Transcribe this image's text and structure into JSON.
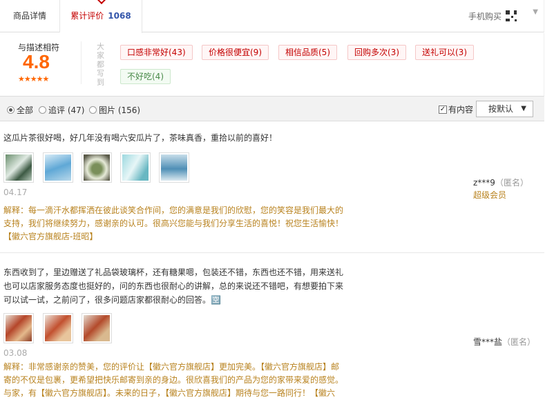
{
  "tabs": {
    "detail_label": "商品详情",
    "reviews_label": "累计评价",
    "reviews_count": "1068",
    "mobile_buy": "手机购买"
  },
  "summary": {
    "score_label": "与描述相符",
    "score": "4.8",
    "stars": "★★★★★",
    "side_label": "大家都写到",
    "tags": [
      {
        "label": "口感非常好(43)",
        "sentiment": "positive"
      },
      {
        "label": "价格很便宜(9)",
        "sentiment": "positive"
      },
      {
        "label": "相信品质(5)",
        "sentiment": "positive"
      },
      {
        "label": "回购多次(3)",
        "sentiment": "positive"
      },
      {
        "label": "送礼可以(3)",
        "sentiment": "positive"
      },
      {
        "label": "不好吃(4)",
        "sentiment": "negative"
      }
    ]
  },
  "filters": {
    "all": "全部",
    "followup": "追评 (47)",
    "pictures": "图片 (156)",
    "selected": "全部",
    "has_content": "有内容",
    "has_content_checked": true,
    "sort_label": "按默认"
  },
  "reviews": [
    {
      "text": "这瓜片茶很好喝，好几年没有喝六安瓜片了，茶味真香，重拾以前的喜好！",
      "date": "04.17",
      "user": "z***9",
      "anon": "（匿名）",
      "level": "超级会员",
      "reply": "解释：每一滴汗水都挥洒在彼此谈笑合作间，您的满意是我们的欣慰，您的笑容是我们最大的支持，我们将继续努力，感谢亲的认可。很高兴您能与我们分享生活的喜悦！祝您生活愉快！【徽六官方旗舰店-班昭】"
    },
    {
      "text": "东西收到了，里边赠送了礼品袋玻璃杯，还有糖果嗯，包装还不错，东西也还不错，用来送礼也可以店家服务态度也挺好的，问的东西也很耐心的讲解，总的来说还不错吧，有想要拍下来可以试一试，之前问了，很多问题店家都很耐心的回答。🈳",
      "date": "03.08",
      "user": "雪***盐",
      "anon": "（匿名）",
      "reply": "解释：非常感谢亲的赞美，您的评价让【徽六官方旗舰店】更加完美。【徽六官方旗舰店】邮寄的不仅是包裹，更希望把快乐邮寄到亲的身边。很欣喜我们的产品为您的家带来爱的感觉。与家，有【徽六官方旗舰店】。未来的日子，【徽六官方旗舰店】期待与您一路同行！【徽六"
    }
  ],
  "colors": {
    "accent_red": "#c40000",
    "score_orange": "#ff6600",
    "reply_brown": "#b8821e"
  }
}
